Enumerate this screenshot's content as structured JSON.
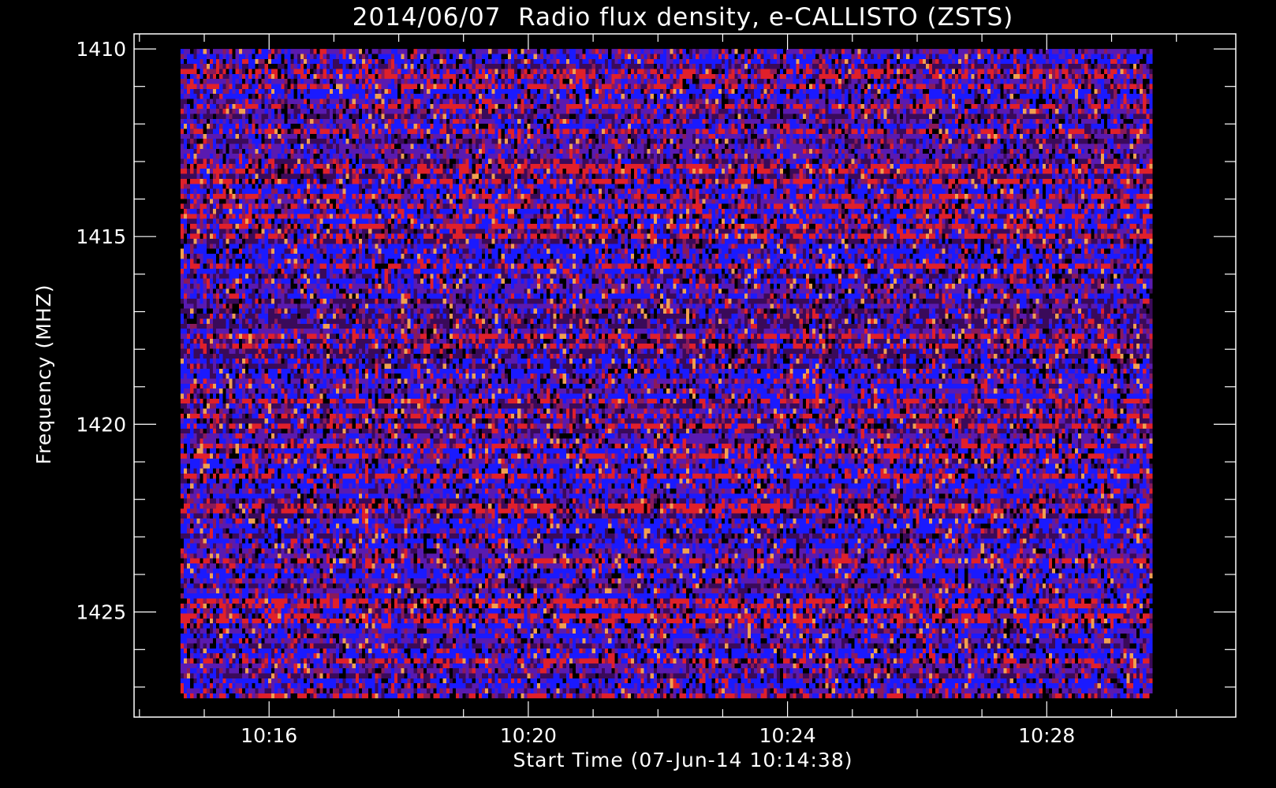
{
  "chart_data": {
    "type": "heatmap",
    "title": "2014/06/07  Radio flux density, e-CALLISTO (ZSTS)",
    "xlabel": "Start Time (07-Jun-14 10:14:38)",
    "ylabel": "Frequency (MHZ)",
    "x": {
      "unit": "time",
      "range": [
        "10:14:38",
        "10:29:38"
      ],
      "axis_range": [
        "10:13:55",
        "10:30:55"
      ],
      "major_ticks": [
        "10:16",
        "10:20",
        "10:24",
        "10:28"
      ],
      "minor_tick_interval_minutes": 1
    },
    "y": {
      "unit": "MHz",
      "data_range": [
        1410,
        1427.3
      ],
      "axis_range": [
        1409.6,
        1427.8
      ],
      "major_ticks": [
        1410,
        1415,
        1420,
        1425
      ],
      "minor_tick_interval": 1,
      "inverted": true
    },
    "colormap": [
      "#000000",
      "#3a0a5a",
      "#1a1aff",
      "#5a1ab0",
      "#8a1a5a",
      "#e0202a",
      "#f0a050"
    ],
    "pattern": {
      "time_columns": 300,
      "frequency_rows": 130,
      "description_note": "noise-dominated spectrogram, no burst"
    },
    "grid": false,
    "legend": "none"
  }
}
